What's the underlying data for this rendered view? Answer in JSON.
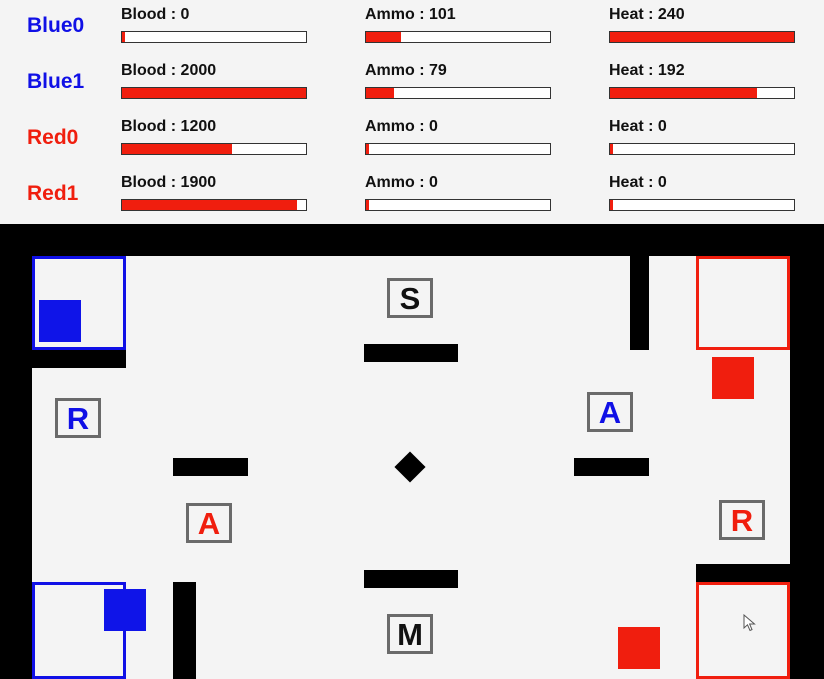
{
  "colors": {
    "blue": "#1010e6",
    "red": "#f01e0e",
    "bar_fill": "#f01e0e"
  },
  "robots": [
    {
      "name": "Blue0",
      "team": "blue",
      "blood": {
        "label": "Blood : 0",
        "fraction": 0.0
      },
      "ammo": {
        "label": "Ammo : 101",
        "fraction": 0.19
      },
      "heat": {
        "label": "Heat : 240",
        "fraction": 1.0
      }
    },
    {
      "name": "Blue1",
      "team": "blue",
      "blood": {
        "label": "Blood : 2000",
        "fraction": 1.0
      },
      "ammo": {
        "label": "Ammo : 79",
        "fraction": 0.15
      },
      "heat": {
        "label": "Heat : 192",
        "fraction": 0.8
      }
    },
    {
      "name": "Red0",
      "team": "red",
      "blood": {
        "label": "Blood : 1200",
        "fraction": 0.6
      },
      "ammo": {
        "label": "Ammo : 0",
        "fraction": 0.0
      },
      "heat": {
        "label": "Heat : 0",
        "fraction": 0.0
      }
    },
    {
      "name": "Red1",
      "team": "red",
      "blood": {
        "label": "Blood : 1900",
        "fraction": 0.95
      },
      "ammo": {
        "label": "Ammo : 0",
        "fraction": 0.0
      },
      "heat": {
        "label": "Heat : 0",
        "fraction": 0.0
      }
    }
  ],
  "arena": {
    "pads": {
      "supply": "S",
      "middle": "M",
      "blue_reload": "R",
      "red_reload": "R",
      "blue_ammo": "A",
      "red_ammo": "A"
    },
    "center_marker_icon": "diamond-icon",
    "cursor_icon": "mouse-pointer-icon"
  }
}
